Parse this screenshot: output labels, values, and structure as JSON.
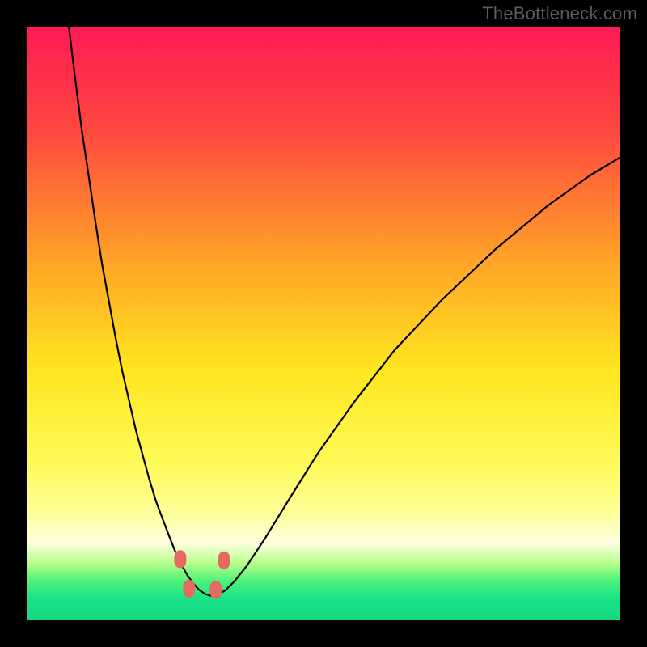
{
  "watermark": {
    "text": "TheBottleneck.com"
  },
  "chart_data": {
    "type": "line",
    "title": "",
    "xlabel": "",
    "ylabel": "",
    "xlim": [
      0,
      100
    ],
    "ylim": [
      0,
      100
    ],
    "gradient_stops": [
      {
        "offset": 0.0,
        "color": "#ff1a55"
      },
      {
        "offset": 0.18,
        "color": "#ff4a3f"
      },
      {
        "offset": 0.4,
        "color": "#ffa626"
      },
      {
        "offset": 0.58,
        "color": "#ffe61f"
      },
      {
        "offset": 0.74,
        "color": "#fffb5a"
      },
      {
        "offset": 0.82,
        "color": "#ffff9a"
      },
      {
        "offset": 0.87,
        "color": "#ffffe0"
      },
      {
        "offset": 0.905,
        "color": "#b7ff8a"
      },
      {
        "offset": 0.935,
        "color": "#4cf27a"
      },
      {
        "offset": 0.965,
        "color": "#1ae286"
      },
      {
        "offset": 1.0,
        "color": "#16d884"
      }
    ],
    "series": [
      {
        "name": "bottleneck-curve",
        "x": [
          7.0,
          8.1,
          9.2,
          10.4,
          11.5,
          12.6,
          13.8,
          14.9,
          16.0,
          17.2,
          18.3,
          19.5,
          20.6,
          21.7,
          22.9,
          24.0,
          25.0,
          26.0,
          27.0,
          28.0,
          29.0,
          30.0,
          31.0,
          32.2,
          33.5,
          35.0,
          37.0,
          40.0,
          44.0,
          49.0,
          55.0,
          62.0,
          70.0,
          79.0,
          88.0,
          95.0,
          100.0
        ],
        "values": [
          100.0,
          91.0,
          82.5,
          74.5,
          67.0,
          60.0,
          53.5,
          47.5,
          42.0,
          36.8,
          32.0,
          27.6,
          23.6,
          20.0,
          16.8,
          13.9,
          11.4,
          9.3,
          7.5,
          6.1,
          5.0,
          4.3,
          4.0,
          4.2,
          5.0,
          6.5,
          9.0,
          13.5,
          20.0,
          28.0,
          36.5,
          45.5,
          54.0,
          62.5,
          70.0,
          75.0,
          78.0
        ]
      }
    ],
    "markers": [
      {
        "x": 25.8,
        "y": 10.2
      },
      {
        "x": 27.3,
        "y": 5.2
      },
      {
        "x": 31.8,
        "y": 5.0
      },
      {
        "x": 33.2,
        "y": 10.0
      }
    ]
  },
  "plot": {
    "outer_w": 800,
    "outer_h": 800,
    "inner_x": 34,
    "inner_y": 34,
    "inner_w": 732,
    "inner_h": 732
  }
}
